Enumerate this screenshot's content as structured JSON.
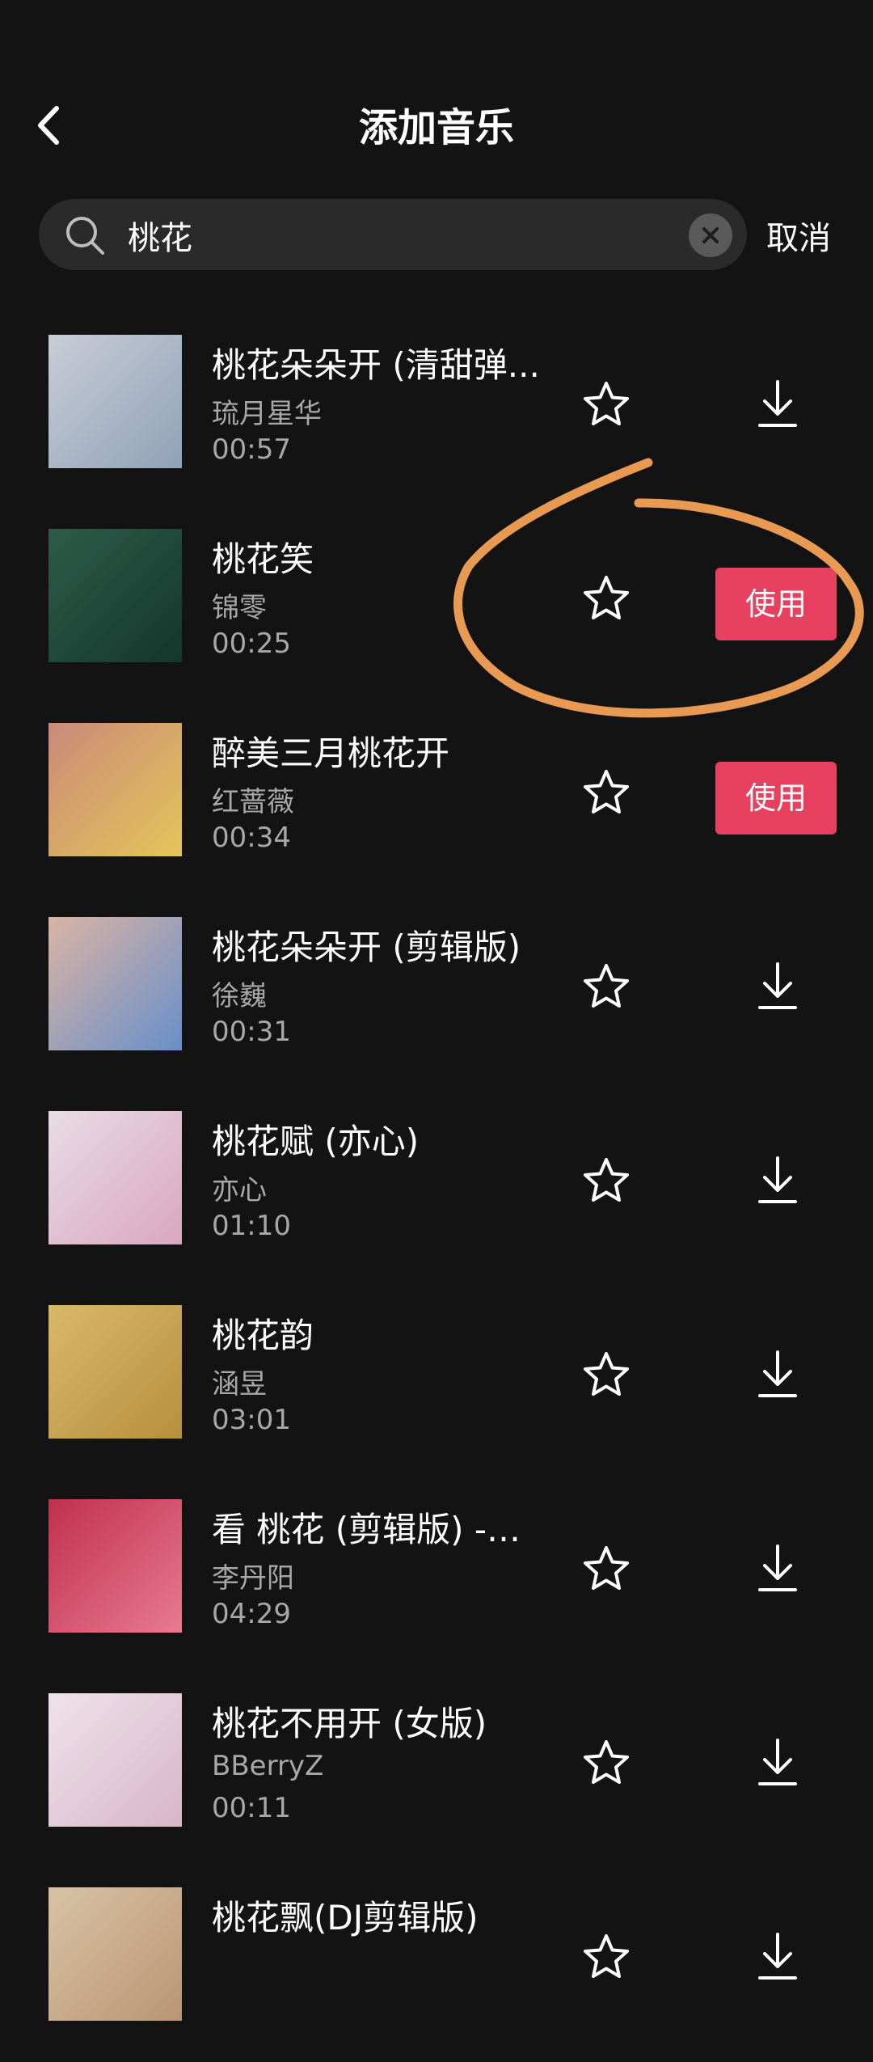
{
  "header": {
    "title": "添加音乐",
    "cancel_label": "取消"
  },
  "search": {
    "value": "桃花"
  },
  "colors": {
    "background": "#131313",
    "search_bg": "#2a2a2a",
    "accent_use": "#e8405f",
    "secondary_text": "#a8a8a8",
    "annotation": "#e89a52"
  },
  "icons": {
    "back": "chevron-left-icon",
    "search": "magnifier-icon",
    "clear": "clear-circle-x-icon",
    "favorite": "star-outline-icon",
    "download": "download-arrow-icon"
  },
  "songs": [
    {
      "title": "桃花朵朵开 (清甜弹...",
      "artist": "琉月星华",
      "duration": "00:57",
      "action": "download"
    },
    {
      "title": "桃花笑",
      "artist": "锦零",
      "duration": "00:25",
      "action": "use",
      "action_label": "使用"
    },
    {
      "title": "醉美三月桃花开",
      "artist": "红蔷薇",
      "duration": "00:34",
      "action": "use",
      "action_label": "使用"
    },
    {
      "title": "桃花朵朵开 (剪辑版)",
      "artist": "徐巍",
      "duration": "00:31",
      "action": "download"
    },
    {
      "title": "桃花赋 (亦心)",
      "artist": "亦心",
      "duration": "01:10",
      "action": "download"
    },
    {
      "title": "桃花韵",
      "artist": "涵昱",
      "duration": "03:01",
      "action": "download"
    },
    {
      "title": "看 桃花 (剪辑版) -李...",
      "artist": "李丹阳",
      "duration": "04:29",
      "action": "download"
    },
    {
      "title": "桃花不用开 (女版)",
      "artist": "BBerryZ",
      "duration": "00:11",
      "action": "download"
    },
    {
      "title": "桃花飘(DJ剪辑版)",
      "artist": "",
      "duration": "",
      "action": "download"
    }
  ]
}
